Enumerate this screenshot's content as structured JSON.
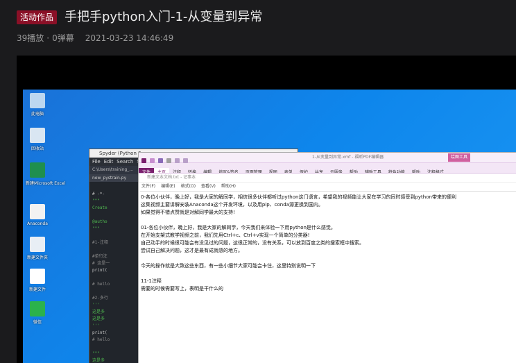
{
  "header": {
    "badge": "活动作品",
    "title": "手把手python入门-1-从变量到异常",
    "plays": "39播放",
    "separator": "·",
    "danmaku": "0弹幕",
    "datetime": "2021-03-23 14:46:49"
  },
  "colors": {
    "badge_bg": "#8a1027",
    "desktop_blue": "#0e86ec",
    "notepad_accent": "#7a1f6d"
  },
  "desktop_icons": [
    {
      "label": "此电脑",
      "icon": "computer-icon",
      "color": "#bcd7f0"
    },
    {
      "label": "回收站",
      "icon": "recycle-bin-icon",
      "color": "#d9e6f2"
    },
    {
      "label": "新建Microsoft Excel",
      "icon": "excel-icon",
      "color": "#1f8f4e"
    },
    {
      "label": "Anaconda",
      "icon": "folder-icon",
      "color": "#f2f2f2"
    },
    {
      "label": "新建文件夹",
      "icon": "shortcut-icon",
      "color": "#e8eef5"
    },
    {
      "label": "新建文件",
      "icon": "qr-icon",
      "color": "#ffffff"
    },
    {
      "label": "微信",
      "icon": "wechat-icon",
      "color": "#2bb24c"
    }
  ],
  "spyder": {
    "title": "Spyder (Python 3",
    "menu": [
      "File",
      "Edit",
      "Search",
      "Sou"
    ],
    "path": "C:\\Users\\training_...",
    "tab": "new_pystrain.py",
    "code_lines": [
      {
        "num": "",
        "text": "# -*-",
        "color": "#c8c8c8"
      },
      {
        "num": "",
        "text": "\"\"\"",
        "color": "#4fb84f"
      },
      {
        "num": "",
        "text": "Create",
        "color": "#4fb84f"
      },
      {
        "num": "",
        "text": "",
        "color": "#c8c8c8"
      },
      {
        "num": "",
        "text": "@autho",
        "color": "#4fb84f"
      },
      {
        "num": "",
        "text": "\"\"\"",
        "color": "#4fb84f"
      },
      {
        "num": "",
        "text": "",
        "color": "#c8c8c8"
      },
      {
        "num": "",
        "text": "#1-注释",
        "color": "#8c8c8c"
      },
      {
        "num": "",
        "text": "",
        "color": "#c8c8c8"
      },
      {
        "num": "",
        "text": "#单行注",
        "color": "#8c8c8c"
      },
      {
        "num": "",
        "text": "# 这是一",
        "color": "#8c8c8c"
      },
      {
        "num": "",
        "text": "print(",
        "color": "#c8c8c8"
      },
      {
        "num": "",
        "text": "",
        "color": "#c8c8c8"
      },
      {
        "num": "",
        "text": "# hello",
        "color": "#8c8c8c"
      },
      {
        "num": "",
        "text": "",
        "color": "#c8c8c8"
      },
      {
        "num": "",
        "text": "#2-多行",
        "color": "#8c8c8c"
      },
      {
        "num": "",
        "text": "'''",
        "color": "#4fb84f"
      },
      {
        "num": "",
        "text": "这是多",
        "color": "#4fb84f"
      },
      {
        "num": "",
        "text": "这是多",
        "color": "#4fb84f"
      },
      {
        "num": "",
        "text": "'''",
        "color": "#4fb84f"
      },
      {
        "num": "",
        "text": "print(",
        "color": "#c8c8c8"
      },
      {
        "num": "",
        "text": "# hello",
        "color": "#8c8c8c"
      },
      {
        "num": "",
        "text": "",
        "color": "#c8c8c8"
      },
      {
        "num": "",
        "text": "\"\"\"",
        "color": "#4fb84f"
      },
      {
        "num": "",
        "text": "这是多",
        "color": "#4fb84f"
      },
      {
        "num": "",
        "text": "这是多",
        "color": "#4fb84f"
      }
    ]
  },
  "notepad": {
    "doc_title": "1-从变量到异常.xmf - 福昕PDF编辑器",
    "tool_tab": "绘图工具",
    "ribbon": [
      "文件",
      "主页",
      "注释",
      "转换",
      "编辑",
      "填写&签名",
      "页面管理",
      "视图",
      "表单",
      "保护",
      "共享",
      "云服务",
      "帮助",
      "辅助工具",
      "特色功能",
      "帮助",
      "注释格式"
    ],
    "inner_title": "新建文本文档.txt - 记事本",
    "menu": [
      "文件(F)",
      "编辑(E)",
      "格式(O)",
      "查看(V)",
      "帮助(H)"
    ],
    "lines": [
      "0-各位小伙伴，晚上好，我是大家的解同学，相信很多伙伴都听过python这门语言，希望我的视频能让大家在学习的同时感受到python带来的便利",
      "这集视频主要讲解安装Anaconda这个开发环境，以及用pip、conda源更换到国内。",
      "如果觉得不错点赞就是对解同学最大的支持!",
      "",
      "01-各位小伙伴，晚上好，我是大家的解同学，今天我们来体验一下用python是什么感觉。",
      "在开始支架式教学视频之前，我们先用Ctrl+c、Ctrl+v实现一个简单的分类器!",
      "自己动手的时候很可能会有没见过的问题，这很正常的，没有关系，可以放到百度之类的搜索框中搜索。",
      "尝试自己解决问题，这才是最有成就感的地方。",
      "",
      "今天的操作就是大致这些东西，有一些小细节大家可能会卡住，这里特别说明一下",
      "",
      "11-1注释",
      "需要的时候需要写上，表明是干什么的"
    ]
  }
}
